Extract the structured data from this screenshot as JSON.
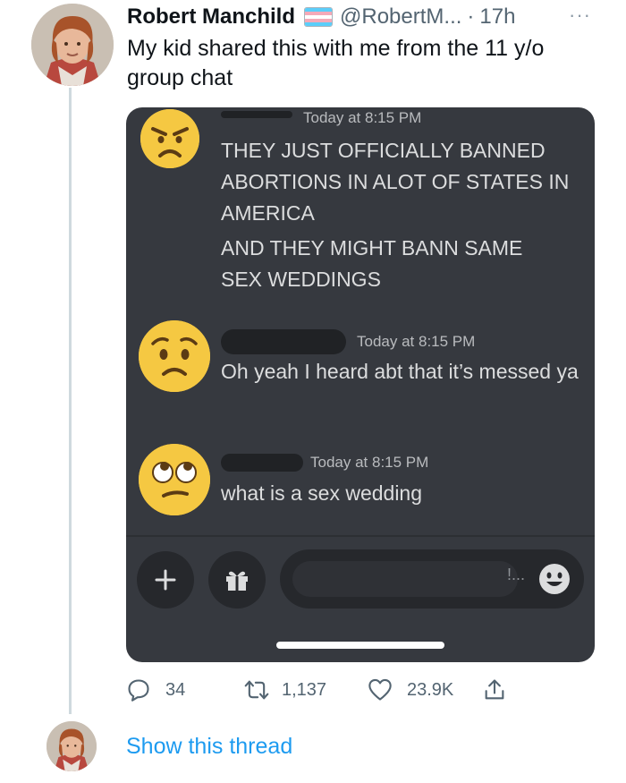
{
  "tweet": {
    "display_name": "Robert Manchild",
    "handle": "@RobertM...",
    "separator": "·",
    "time": "17h",
    "more": "···",
    "text": "My kid shared this with me from the 11 y/o group chat"
  },
  "screenshot": {
    "messages": [
      {
        "emoji": "angry-face",
        "timestamp": "Today at 8:15 PM",
        "lines": [
          "THEY JUST OFFICIALLY BANNED ABORTIONS IN  ALOT OF STATES IN AMERICA",
          "AND THEY MIGHT BANN SAME SEX WEDDINGS"
        ]
      },
      {
        "emoji": "worried-face",
        "timestamp": "Today at 8:15 PM",
        "lines": [
          "Oh yeah I heard abt that it’s messed ya"
        ]
      },
      {
        "emoji": "eye-roll-face",
        "timestamp": "Today at 8:15 PM",
        "lines": [
          "what is a sex wedding"
        ]
      }
    ],
    "input_ellipsis": "!..."
  },
  "actions": {
    "replies": "34",
    "retweets": "1,137",
    "likes": "23.9K"
  },
  "thread": {
    "show_label": "Show this thread"
  },
  "colors": {
    "discord_bg": "#36393f",
    "link_blue": "#1d9bf0",
    "muted_gray": "#536471"
  }
}
